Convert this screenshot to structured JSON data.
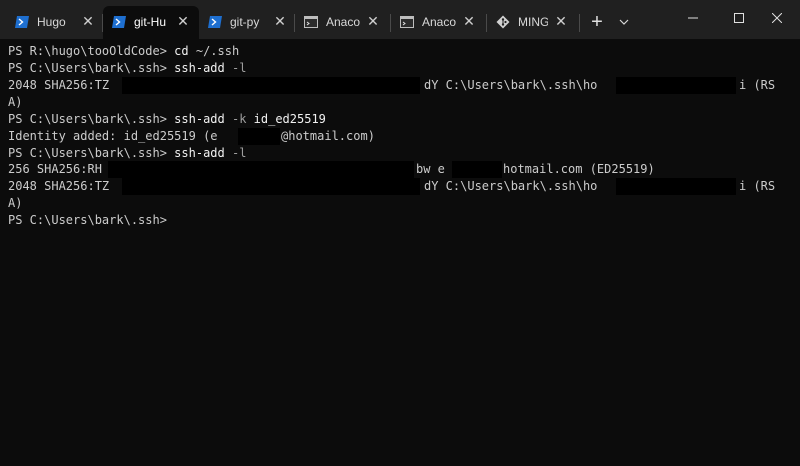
{
  "window": {
    "tabs": [
      {
        "label": "Hugo",
        "icon": "powershell-icon",
        "active": false
      },
      {
        "label": "git-Hu",
        "icon": "powershell-icon",
        "active": true
      },
      {
        "label": "git-py",
        "icon": "powershell-icon",
        "active": false
      },
      {
        "label": "Anaco",
        "icon": "console-icon",
        "active": false
      },
      {
        "label": "Anaco",
        "icon": "console-icon",
        "active": false
      },
      {
        "label": "MINGV",
        "icon": "git-bash-icon",
        "active": false
      }
    ],
    "close_glyph": "✕",
    "newtab_glyph": "+",
    "colors": {
      "titlebar": "#202020",
      "terminal_bg": "#0c0c0c",
      "powershell_icon": "#1e6fd0"
    }
  },
  "terminal": {
    "lines": [
      {
        "prompt": "PS R:\\hugo\\tooOldCode> ",
        "cmd": "cd",
        "rest": " ~/.ssh"
      },
      {
        "prompt": "PS C:\\Users\\bark\\.ssh> ",
        "cmd": "ssh-add",
        "flag": " -l",
        "rest": ""
      },
      {
        "text_a": "2048 SHA256:TZ",
        "text_b": "dY C:\\Users\\bark\\.ssh\\ho",
        "text_c": "i (RS"
      },
      {
        "text": "A)"
      },
      {
        "prompt": "PS C:\\Users\\bark\\.ssh> ",
        "cmd": "ssh-add",
        "flag": " -k",
        "rest": " id_ed25519"
      },
      {
        "text_a": "Identity added: id_ed25519 (e",
        "text_b": "@hotmail.com)"
      },
      {
        "prompt": "PS C:\\Users\\bark\\.ssh> ",
        "cmd": "ssh-add",
        "flag": " -l",
        "rest": ""
      },
      {
        "text_a": "256 SHA256:RH",
        "text_b": "bw e",
        "text_c": "hotmail.com (ED25519)"
      },
      {
        "text_a": "2048 SHA256:TZ",
        "text_b": "dY C:\\Users\\bark\\.ssh\\ho",
        "text_c": "i (RS"
      },
      {
        "text": "A)"
      },
      {
        "prompt": "PS C:\\Users\\bark\\.ssh>",
        "cmd": "",
        "rest": ""
      }
    ]
  }
}
